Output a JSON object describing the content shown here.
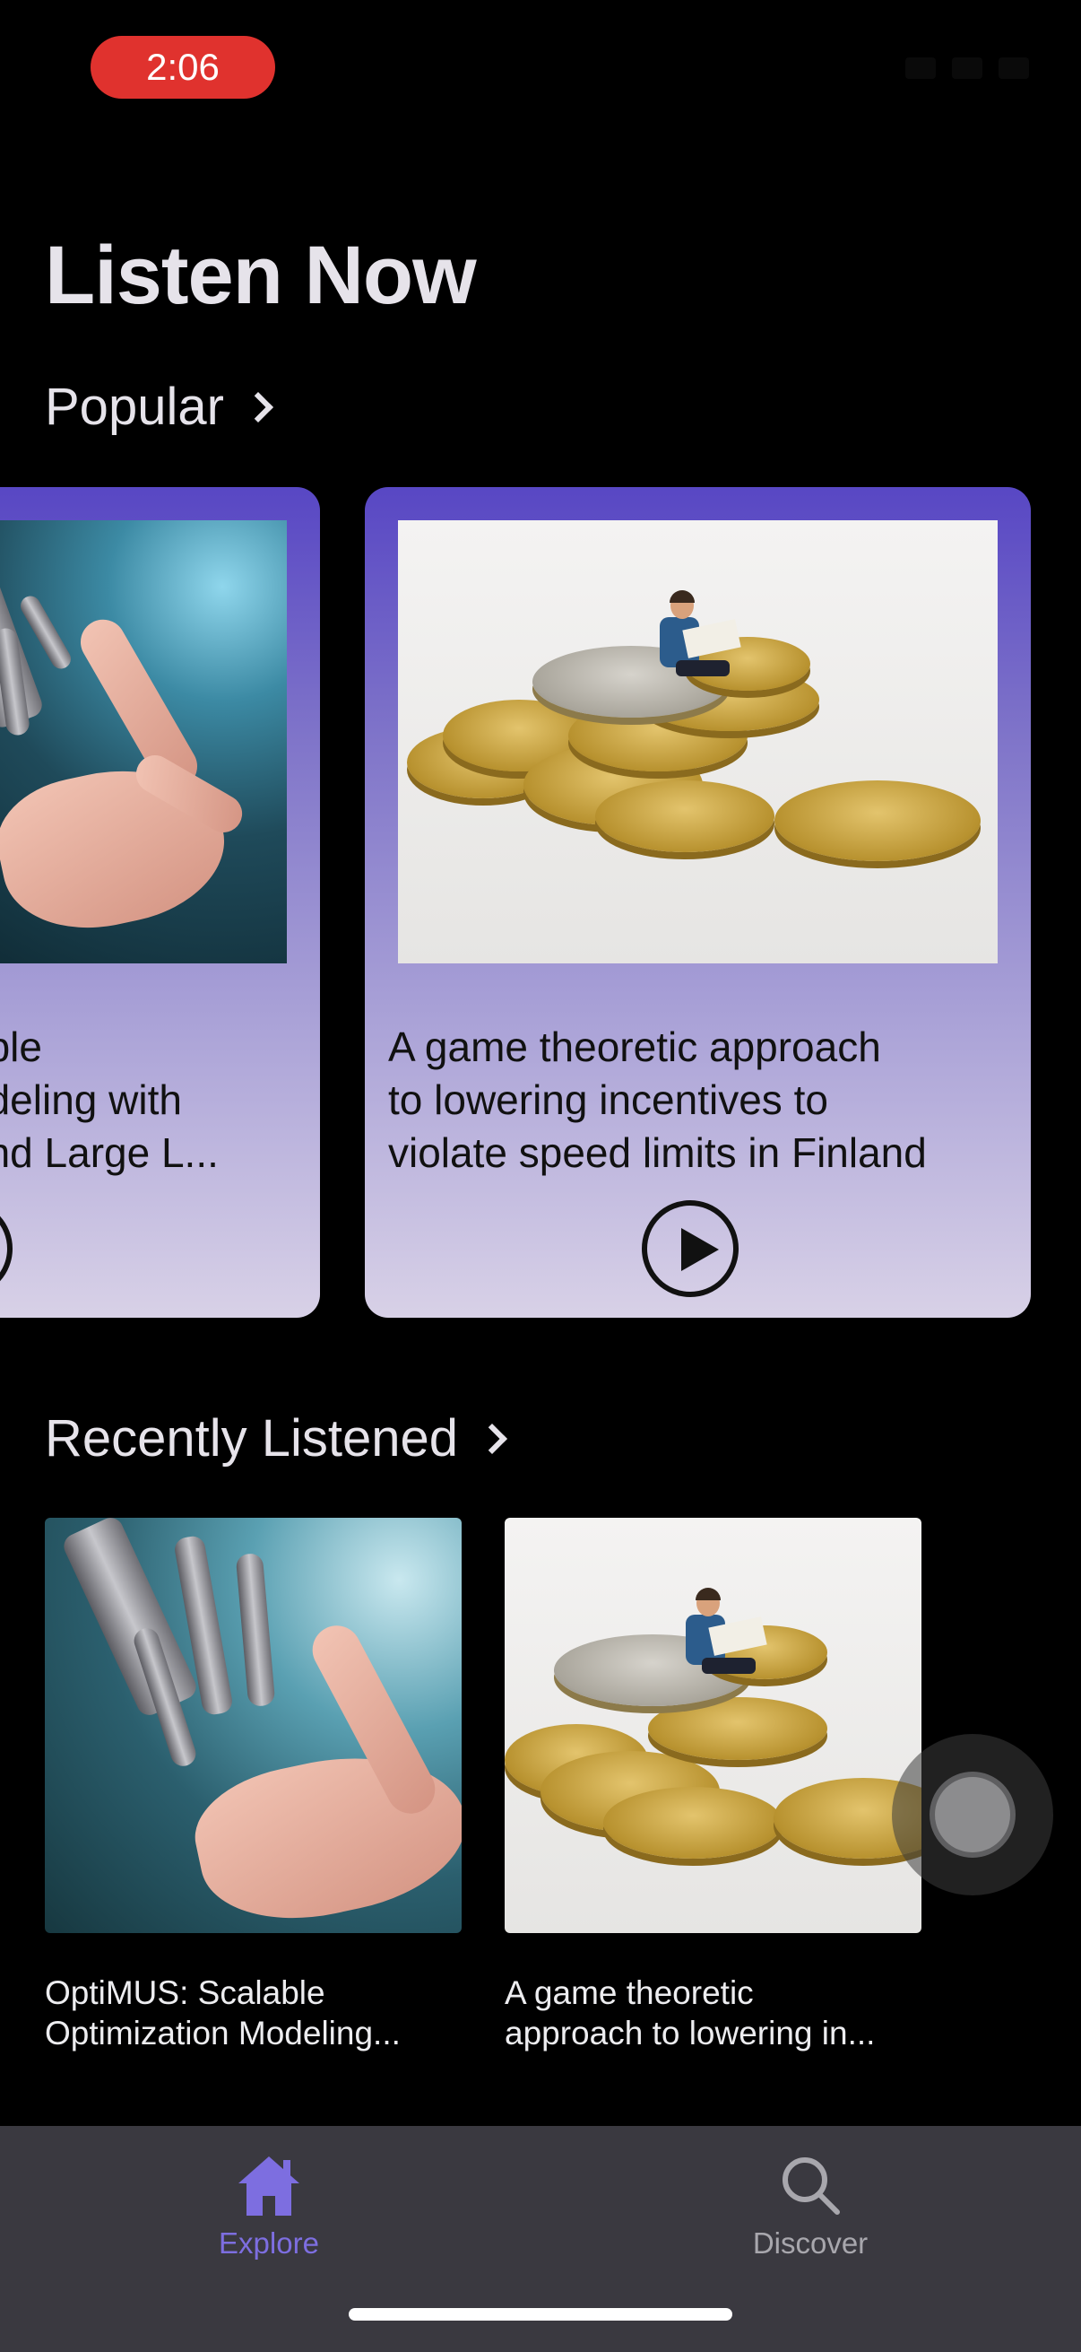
{
  "status_bar": {
    "time": "2:06"
  },
  "header": {
    "title": "Listen Now"
  },
  "popular": {
    "section_label": "Popular",
    "cards": [
      {
        "title_lines": [
          "able",
          "odeling with",
          "and Large L..."
        ],
        "image": "robot-hand-image"
      },
      {
        "title_lines": [
          "A game theoretic approach",
          "to lowering incentives to",
          "violate speed limits in Finland"
        ],
        "image": "coins-man-image"
      }
    ]
  },
  "recent": {
    "section_label": "Recently Listened",
    "items": [
      {
        "title_lines": [
          "OptiMUS: Scalable",
          "Optimization Modeling..."
        ],
        "image": "robot-hand-image"
      },
      {
        "title_lines": [
          "A game theoretic",
          "approach to lowering in..."
        ],
        "image": "coins-man-image"
      }
    ]
  },
  "tab_bar": {
    "tabs": [
      {
        "label": "Explore",
        "icon": "home-icon",
        "active": true
      },
      {
        "label": "Discover",
        "icon": "search-icon",
        "active": false
      }
    ]
  },
  "colors": {
    "accent": "#7d6ee0",
    "card_gradient_top": "#5847c4",
    "card_gradient_bottom": "#d8d1e7",
    "tab_bar": "#3a3940",
    "time_pill": "#e0322e"
  }
}
